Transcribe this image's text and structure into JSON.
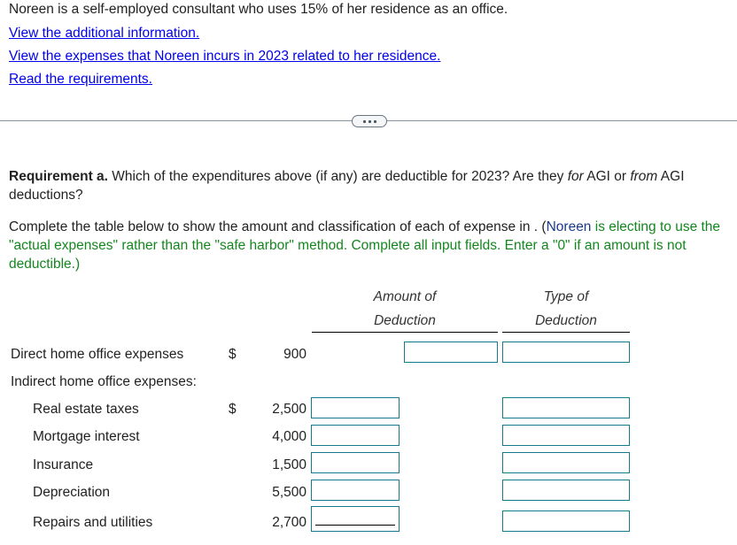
{
  "intro": "Noreen is a self-employed consultant who uses 15% of her residence as an office.",
  "links": {
    "additional_info": "View the additional information.",
    "expenses": "View the expenses that Noreen incurs in 2023 related to her residence.",
    "requirements": "Read the requirements."
  },
  "divider_button": "more-options",
  "requirement": {
    "label": "Requirement a.",
    "text_1": " Which of the expenditures above (if any) are deductible for 2023? Are they ",
    "for": "for",
    "text_2": " AGI or ",
    "from": "from",
    "text_3": " AGI deductions?"
  },
  "instructions": {
    "main": "Complete the table below to show the amount and classification of each of expense in . (",
    "name": "Noreen",
    "green": " is electing to use the \"actual expenses\" rather than the \"safe harbor\" method. Complete all input fields. Enter a \"0\" if an amount is not deductible.)"
  },
  "table": {
    "headers": {
      "amount_line1": "Amount of",
      "amount_line2": "Deduction",
      "type_line1": "Type of",
      "type_line2": "Deduction"
    },
    "direct": {
      "label": "Direct home office expenses",
      "currency": "$",
      "amount": "900",
      "deduction_amount": "",
      "deduction_type": ""
    },
    "indirect_label": "Indirect home office expenses:",
    "rows": [
      {
        "label": "Real estate taxes",
        "currency": "$",
        "amount": "2,500",
        "deduction_amount": "",
        "deduction_type": ""
      },
      {
        "label": "Mortgage interest",
        "currency": "",
        "amount": "4,000",
        "deduction_amount": "",
        "deduction_type": ""
      },
      {
        "label": "Insurance",
        "currency": "",
        "amount": "1,500",
        "deduction_amount": "",
        "deduction_type": ""
      },
      {
        "label": "Depreciation",
        "currency": "",
        "amount": "5,500",
        "deduction_amount": "",
        "deduction_type": ""
      },
      {
        "label": "Repairs and utilities",
        "currency": "",
        "amount": "2,700",
        "deduction_amount": "",
        "deduction_type": ""
      }
    ]
  },
  "colors": {
    "link": "#0000ee",
    "instruction_green": "#14861e",
    "input_border": "#157a8c"
  }
}
